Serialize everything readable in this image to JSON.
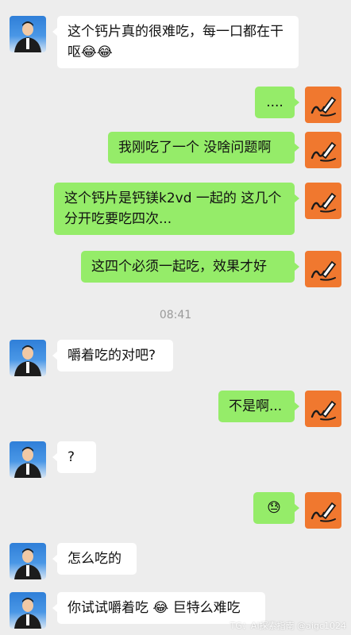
{
  "conversation": {
    "messages": [
      {
        "side": "in",
        "text": "这个钙片真的很难吃，每一口都在干呕😂😂"
      },
      {
        "side": "out",
        "text": "...."
      },
      {
        "side": "out",
        "text": "我刚吃了一个 没啥问题啊"
      },
      {
        "side": "out",
        "text": "这个钙片是钙镁k2vd 一起的 这几个分开吃要吃四次..."
      },
      {
        "side": "out",
        "text": "这四个必须一起吃，效果才好"
      },
      {
        "side": "in",
        "text": "嚼着吃的对吧?"
      },
      {
        "side": "out",
        "text": "不是啊..."
      },
      {
        "side": "in",
        "text": "?"
      },
      {
        "side": "out",
        "text": "😓"
      },
      {
        "side": "in",
        "text": "怎么吃的"
      },
      {
        "side": "in",
        "text": "你试试嚼着吃 😂 巨特么难吃"
      }
    ],
    "timestamp": "08:41"
  },
  "avatars": {
    "incoming_icon": "person-avatar",
    "outgoing_icon": "pen-scribble-icon"
  },
  "colors": {
    "background": "#ededed",
    "incoming_bubble": "#ffffff",
    "outgoing_bubble": "#95ec69",
    "outgoing_avatar": "#f0782f"
  },
  "watermark": "TG：AI探索指南 @aigc1024"
}
